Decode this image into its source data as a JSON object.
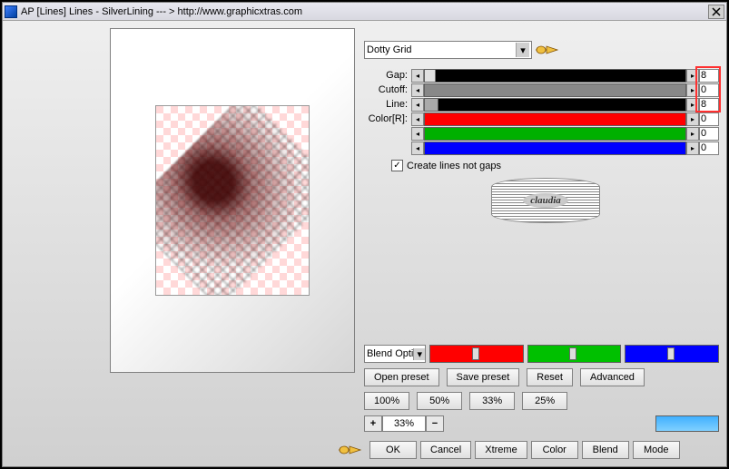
{
  "title": "AP [Lines]  Lines - SilverLining    --- >  http://www.graphicxtras.com",
  "dropdown": {
    "value": "Dotty Grid"
  },
  "sliders": {
    "gap": {
      "label": "Gap:",
      "value": "8"
    },
    "cutoff": {
      "label": "Cutoff:",
      "value": "0"
    },
    "line": {
      "label": "Line:",
      "value": "8"
    },
    "colorR": {
      "label": "Color[R]:",
      "value": "0"
    },
    "colorG": {
      "label": "",
      "value": "0"
    },
    "colorB": {
      "label": "",
      "value": "0"
    }
  },
  "checkbox": {
    "label": "Create lines not gaps",
    "checked": true
  },
  "logo_text": "claudia",
  "blend_option": "Blend Opti",
  "preset_buttons": {
    "open": "Open preset",
    "save": "Save preset",
    "reset": "Reset",
    "advanced": "Advanced"
  },
  "zoom_buttons": {
    "z100": "100%",
    "z50": "50%",
    "z33": "33%",
    "z25": "25%"
  },
  "zoom_value": "33%",
  "action_buttons": {
    "ok": "OK",
    "cancel": "Cancel",
    "xtreme": "Xtreme",
    "color": "Color",
    "blend": "Blend",
    "mode": "Mode"
  },
  "colors": {
    "red": "#ff0000",
    "green": "#00c000",
    "blue": "#0000ff",
    "gray": "#888888",
    "black": "#000000",
    "swatch": "#60c0ff"
  }
}
